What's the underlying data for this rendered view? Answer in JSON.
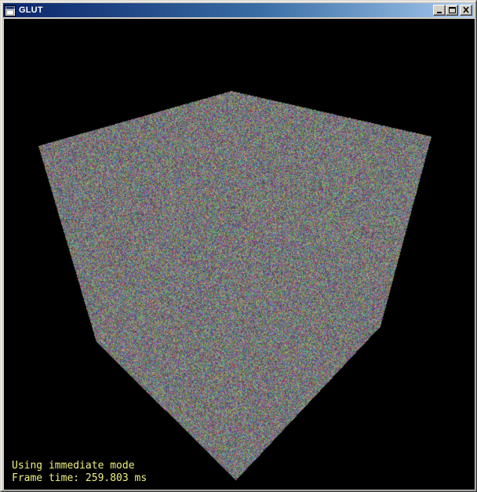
{
  "window": {
    "title": "GLUT",
    "icon": "opengl-app-icon",
    "buttons": {
      "minimize": "minimize-icon",
      "maximize": "maximize-icon",
      "close": "close-icon"
    }
  },
  "viewport": {
    "background": "#000000",
    "scene": "noise-textured-cube"
  },
  "hud": {
    "mode_text": "Using immediate mode",
    "frame_time_text": "Frame time: 259.803 ms",
    "text_color": "#f0f080"
  }
}
